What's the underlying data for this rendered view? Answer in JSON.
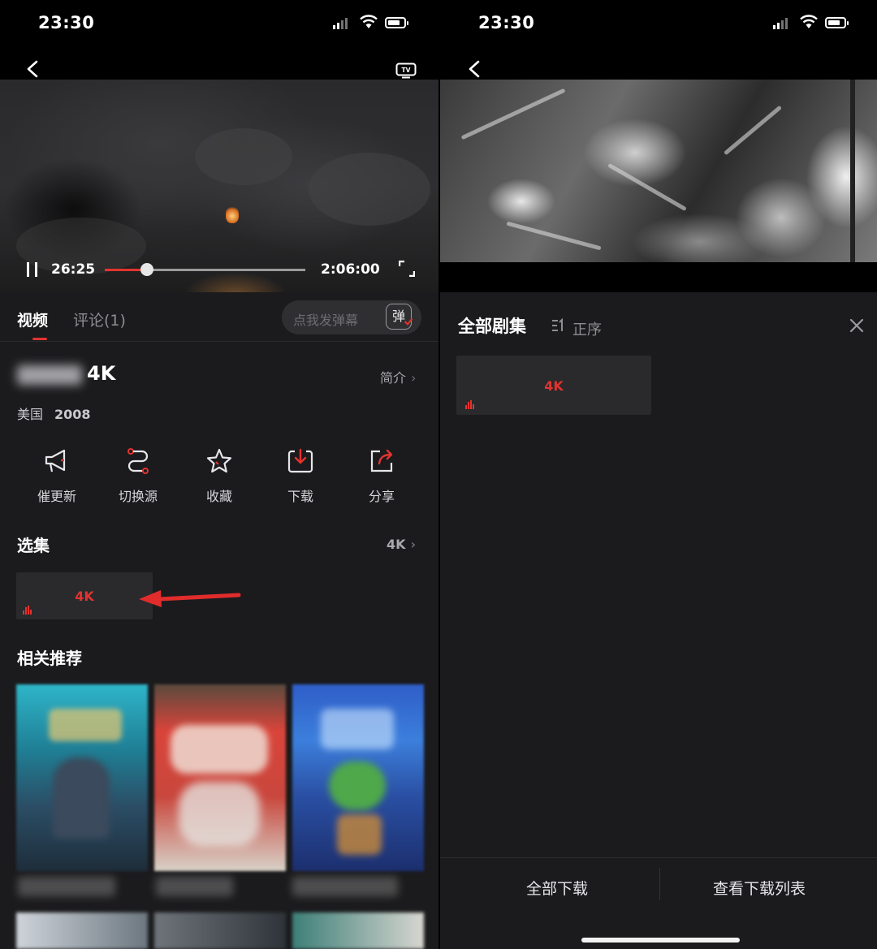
{
  "status_bar": {
    "time": "23:30"
  },
  "player": {
    "current_time": "26:25",
    "duration": "2:06:00",
    "progress": 0.21
  },
  "tabs": {
    "video": "视频",
    "comments": "评论(1)"
  },
  "danmaku": {
    "placeholder": "点我发弹幕",
    "button": "弹"
  },
  "movie": {
    "title_suffix": "4K",
    "intro_link": "简介",
    "region": "美国",
    "year": "2008"
  },
  "actions": [
    {
      "label": "催更新",
      "icon": "megaphone-icon"
    },
    {
      "label": "切换源",
      "icon": "switch-source-icon"
    },
    {
      "label": "收藏",
      "icon": "star-icon"
    },
    {
      "label": "下载",
      "icon": "download-icon"
    },
    {
      "label": "分享",
      "icon": "share-icon"
    }
  ],
  "episodes": {
    "section_title": "选集",
    "more_label": "4K",
    "items": [
      {
        "label": "4K"
      }
    ]
  },
  "related": {
    "section_title": "相关推荐"
  },
  "episode_panel": {
    "title": "全部剧集",
    "sort_label": "正序",
    "items": [
      {
        "label": "4K"
      }
    ],
    "download_all": "全部下载",
    "view_downloads": "查看下载列表"
  },
  "colors": {
    "accent": "#e3332f",
    "background": "#1b1b1d",
    "card": "#2a2a2d"
  }
}
